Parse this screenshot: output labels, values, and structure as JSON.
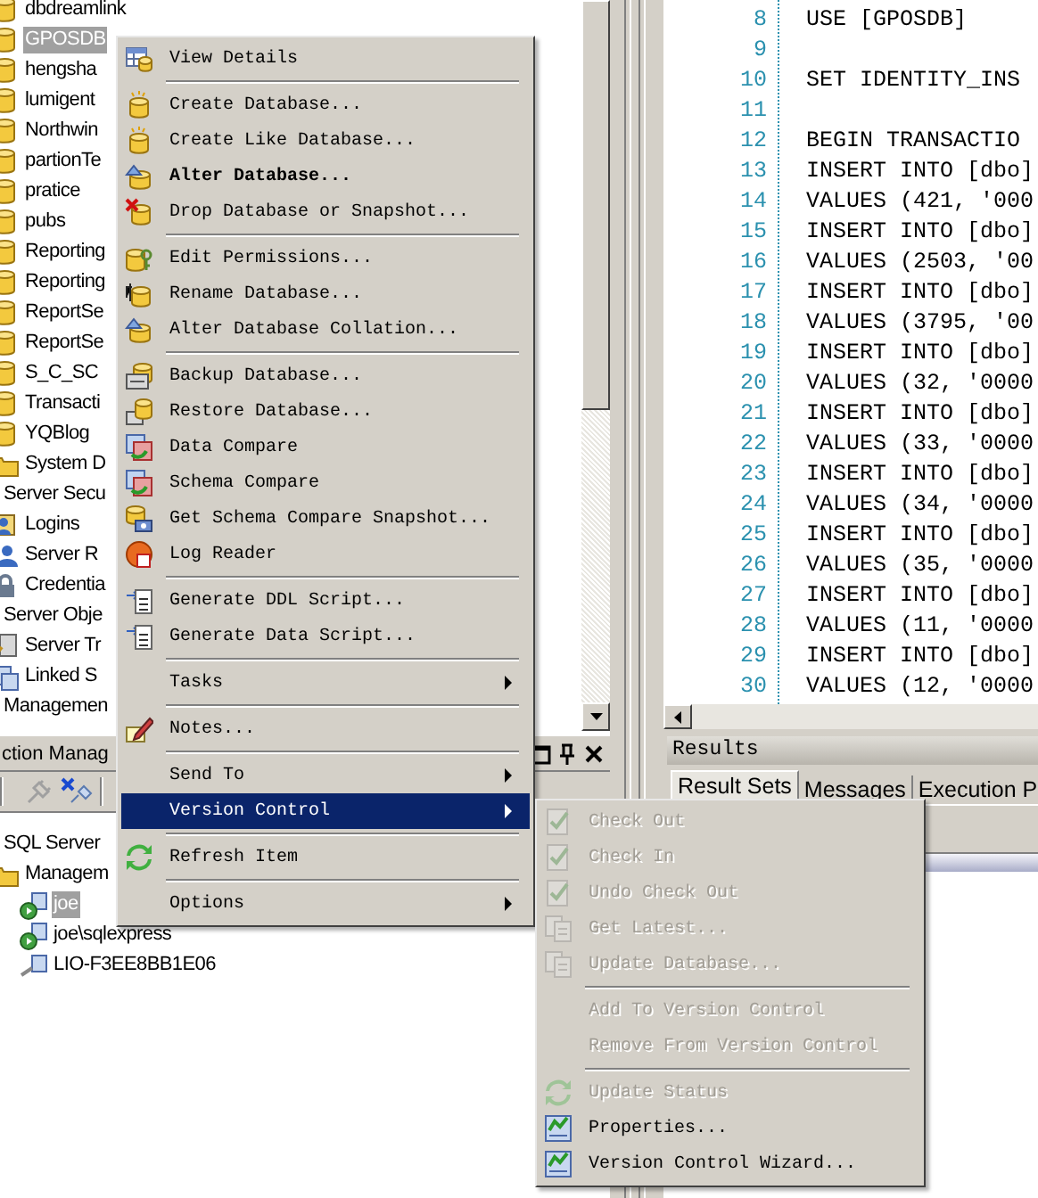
{
  "object_explorer": {
    "items": [
      {
        "label": "dbdreamlink",
        "kind": "database",
        "selected": false
      },
      {
        "label": "GPOSDB",
        "kind": "database",
        "selected": true
      },
      {
        "label": "hengsha",
        "kind": "database",
        "selected": false
      },
      {
        "label": "lumigent",
        "kind": "database",
        "selected": false
      },
      {
        "label": "Northwin",
        "kind": "database",
        "selected": false
      },
      {
        "label": "partionTe",
        "kind": "database",
        "selected": false
      },
      {
        "label": "pratice",
        "kind": "database",
        "selected": false
      },
      {
        "label": "pubs",
        "kind": "database",
        "selected": false
      },
      {
        "label": "Reporting",
        "kind": "database",
        "selected": false
      },
      {
        "label": "Reporting",
        "kind": "database",
        "selected": false
      },
      {
        "label": "ReportSe",
        "kind": "database",
        "selected": false
      },
      {
        "label": "ReportSe",
        "kind": "database",
        "selected": false
      },
      {
        "label": "S_C_SC",
        "kind": "database",
        "selected": false
      },
      {
        "label": "Transacti",
        "kind": "database",
        "selected": false
      },
      {
        "label": "YQBlog",
        "kind": "database",
        "selected": false
      },
      {
        "label": "System D",
        "kind": "folder",
        "selected": false
      },
      {
        "label": "Server Secu",
        "kind": "node",
        "selected": false,
        "children": [
          {
            "label": "Logins",
            "kind": "logins",
            "selected": false
          },
          {
            "label": "Server R",
            "kind": "roles",
            "selected": false
          },
          {
            "label": "Credentia",
            "kind": "credentials",
            "selected": false
          }
        ]
      },
      {
        "label": "Server Obje",
        "kind": "node",
        "selected": false,
        "children": [
          {
            "label": "Server Tr",
            "kind": "triggers",
            "selected": false
          },
          {
            "label": "Linked S",
            "kind": "linked-servers",
            "selected": false
          }
        ]
      },
      {
        "label": "Managemen",
        "kind": "node",
        "selected": false
      }
    ]
  },
  "connection_manager": {
    "title": "ction Manag",
    "items": [
      {
        "label": "SQL Server",
        "kind": "node",
        "selected": false,
        "children": [
          {
            "label": "Managem",
            "kind": "folder",
            "selected": false,
            "children": [
              {
                "label": "joe",
                "kind": "server",
                "selected": true
              },
              {
                "label": "joe\\sqlexpress",
                "kind": "server",
                "selected": false
              },
              {
                "label": "LIO-F3EE8BB1E06",
                "kind": "server-offline",
                "selected": false
              }
            ]
          }
        ]
      }
    ]
  },
  "editor": {
    "lines": [
      {
        "number": "8",
        "code": "USE [GPOSDB]"
      },
      {
        "number": "9"
      },
      {
        "number": "10",
        "code": "SET IDENTITY_INS"
      },
      {
        "number": "11"
      },
      {
        "number": "12",
        "code": "BEGIN TRANSACTIO"
      },
      {
        "number": "13",
        "code": "INSERT INTO [dbo]"
      },
      {
        "number": "14",
        "code": "VALUES (421, '000"
      },
      {
        "number": "15",
        "code": "INSERT INTO [dbo]"
      },
      {
        "number": "16",
        "code": "VALUES (2503, '00"
      },
      {
        "number": "17",
        "code": "INSERT INTO [dbo]"
      },
      {
        "number": "18",
        "code": "VALUES (3795, '00"
      },
      {
        "number": "19",
        "code": "INSERT INTO [dbo]"
      },
      {
        "number": "20",
        "code": "VALUES (32, '0000"
      },
      {
        "number": "21",
        "code": "INSERT INTO [dbo]"
      },
      {
        "number": "22",
        "code": "VALUES (33, '0000"
      },
      {
        "number": "23",
        "code": "INSERT INTO [dbo]"
      },
      {
        "number": "24",
        "code": "VALUES (34, '0000"
      },
      {
        "number": "25",
        "code": "INSERT INTO [dbo]"
      },
      {
        "number": "26",
        "code": "VALUES (35, '0000"
      },
      {
        "number": "27",
        "code": "INSERT INTO [dbo]"
      },
      {
        "number": "28",
        "code": "VALUES (11, '0000"
      },
      {
        "number": "29",
        "code": "INSERT INTO [dbo]"
      },
      {
        "number": "30",
        "code": "VALUES (12, '0000"
      }
    ]
  },
  "results": {
    "title": "Results",
    "tabs": [
      {
        "label": "Result Sets",
        "selected": true
      },
      {
        "label": "Messages",
        "selected": false
      },
      {
        "label": "Execution P",
        "selected": false
      }
    ]
  },
  "context_menu": {
    "items": [
      {
        "kind": "item",
        "label": "View Details",
        "selected": false
      },
      {
        "kind": "separator"
      },
      {
        "kind": "item",
        "label": "Create Database...",
        "selected": false
      },
      {
        "kind": "item",
        "label": "Create Like Database...",
        "selected": false
      },
      {
        "kind": "item",
        "label": "Alter Database...",
        "bold": true,
        "selected": false
      },
      {
        "kind": "item",
        "label": "Drop Database or Snapshot...",
        "selected": false
      },
      {
        "kind": "separator"
      },
      {
        "kind": "item",
        "label": "Edit Permissions...",
        "selected": false
      },
      {
        "kind": "item",
        "label": "Rename Database...",
        "selected": false
      },
      {
        "kind": "item",
        "label": "Alter Database Collation...",
        "selected": false
      },
      {
        "kind": "separator"
      },
      {
        "kind": "item",
        "label": "Backup Database...",
        "selected": false
      },
      {
        "kind": "item",
        "label": "Restore Database...",
        "selected": false
      },
      {
        "kind": "item",
        "label": "Data Compare",
        "selected": false
      },
      {
        "kind": "item",
        "label": "Schema Compare",
        "selected": false
      },
      {
        "kind": "item",
        "label": "Get Schema Compare Snapshot...",
        "selected": false
      },
      {
        "kind": "item",
        "label": "Log Reader",
        "selected": false
      },
      {
        "kind": "separator"
      },
      {
        "kind": "item",
        "label": "Generate DDL Script...",
        "selected": false
      },
      {
        "kind": "item",
        "label": "Generate Data Script...",
        "selected": false
      },
      {
        "kind": "separator"
      },
      {
        "kind": "item",
        "label": "Tasks",
        "submenu": true,
        "selected": false
      },
      {
        "kind": "separator"
      },
      {
        "kind": "item",
        "label": "Notes...",
        "selected": false
      },
      {
        "kind": "separator"
      },
      {
        "kind": "item",
        "label": "Send To",
        "submenu": true,
        "selected": false
      },
      {
        "kind": "item",
        "label": "Version Control",
        "submenu": true,
        "selected": true
      },
      {
        "kind": "separator"
      },
      {
        "kind": "item",
        "label": "Refresh Item",
        "selected": false
      },
      {
        "kind": "separator"
      },
      {
        "kind": "item",
        "label": "Options",
        "submenu": true,
        "selected": false
      }
    ]
  },
  "version_control_menu": {
    "items": [
      {
        "kind": "item",
        "label": "Check Out",
        "disabled": true
      },
      {
        "kind": "item",
        "label": "Check In",
        "disabled": true
      },
      {
        "kind": "item",
        "label": "Undo Check Out",
        "disabled": true
      },
      {
        "kind": "item",
        "label": "Get Latest...",
        "disabled": true
      },
      {
        "kind": "item",
        "label": "Update Database...",
        "disabled": true
      },
      {
        "kind": "separator"
      },
      {
        "kind": "item",
        "label": "Add To Version Control",
        "disabled": true
      },
      {
        "kind": "item",
        "label": "Remove From Version Control",
        "disabled": true
      },
      {
        "kind": "separator"
      },
      {
        "kind": "item",
        "label": "Update Status",
        "disabled": true
      },
      {
        "kind": "item",
        "label": "Properties...",
        "disabled": false
      },
      {
        "kind": "item",
        "label": "Version Control Wizard...",
        "disabled": false
      }
    ]
  }
}
